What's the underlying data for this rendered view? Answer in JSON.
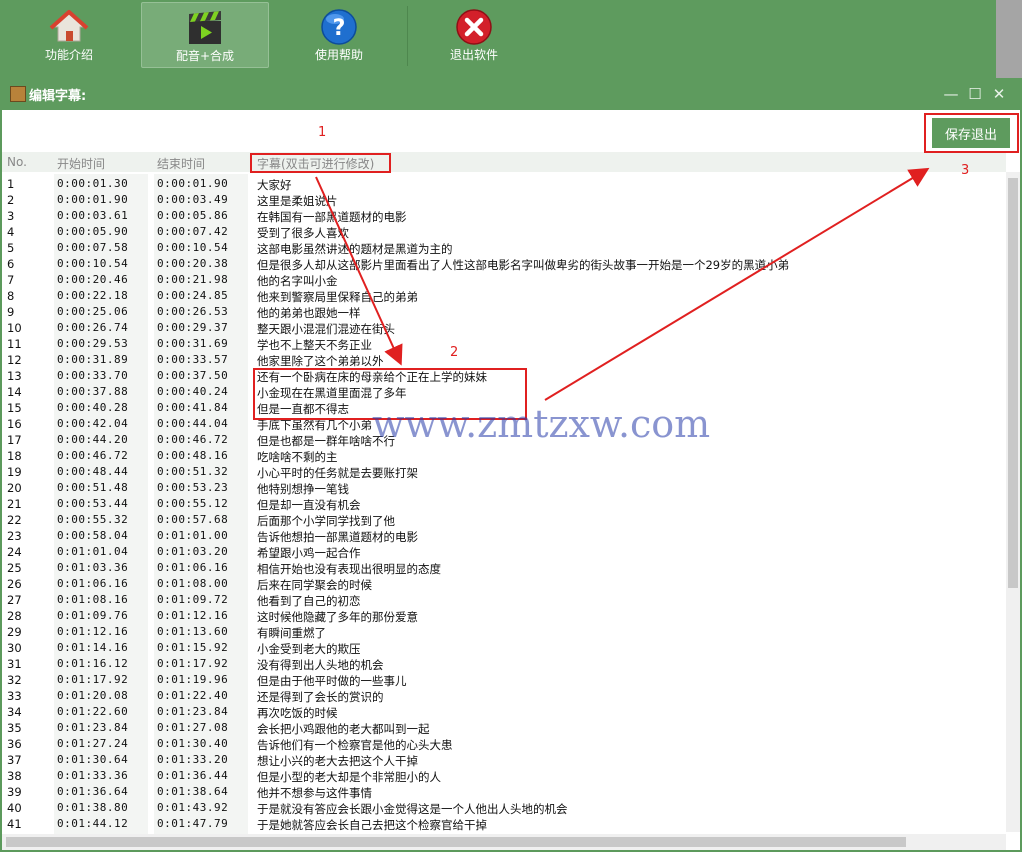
{
  "toolbar": {
    "items": [
      {
        "label": "功能介绍",
        "icon": "home-icon"
      },
      {
        "label": "配音+合成",
        "icon": "video-clapper-icon"
      },
      {
        "label": "使用帮助",
        "icon": "help-icon"
      },
      {
        "label": "退出软件",
        "icon": "exit-icon"
      }
    ]
  },
  "window": {
    "title": "编辑字幕:",
    "minimize_glyph": "—",
    "maximize_glyph": "☐",
    "close_glyph": "✕"
  },
  "save_button_label": "保存退出",
  "table": {
    "headers": [
      "No.",
      "开始时间",
      "结束时间",
      "字幕(双击可进行修改)"
    ],
    "rows": [
      [
        "1",
        "0:00:01.30",
        "0:00:01.90",
        "大家好"
      ],
      [
        "2",
        "0:00:01.90",
        "0:00:03.49",
        "这里是柔姐说片"
      ],
      [
        "3",
        "0:00:03.61",
        "0:00:05.86",
        "在韩国有一部黑道题材的电影"
      ],
      [
        "4",
        "0:00:05.90",
        "0:00:07.42",
        "受到了很多人喜欢"
      ],
      [
        "5",
        "0:00:07.58",
        "0:00:10.54",
        "这部电影虽然讲述的题材是黑道为主的"
      ],
      [
        "6",
        "0:00:10.54",
        "0:00:20.38",
        "但是很多人却从这部影片里面看出了人性这部电影名字叫做卑劣的街头故事一开始是一个29岁的黑道小弟"
      ],
      [
        "7",
        "0:00:20.46",
        "0:00:21.98",
        "他的名字叫小金"
      ],
      [
        "8",
        "0:00:22.18",
        "0:00:24.85",
        "他来到警察局里保释自己的弟弟"
      ],
      [
        "9",
        "0:00:25.06",
        "0:00:26.53",
        "他的弟弟也跟她一样"
      ],
      [
        "10",
        "0:00:26.74",
        "0:00:29.37",
        "整天跟小混混们混迹在街头"
      ],
      [
        "11",
        "0:00:29.53",
        "0:00:31.69",
        "学也不上整天不务正业"
      ],
      [
        "12",
        "0:00:31.89",
        "0:00:33.57",
        "他家里除了这个弟弟以外"
      ],
      [
        "13",
        "0:00:33.70",
        "0:00:37.50",
        "还有一个卧病在床的母亲给个正在上学的妹妹"
      ],
      [
        "14",
        "0:00:37.88",
        "0:00:40.24",
        "小金现在在黑道里面混了多年"
      ],
      [
        "15",
        "0:00:40.28",
        "0:00:41.84",
        "但是一直都不得志"
      ],
      [
        "16",
        "0:00:42.04",
        "0:00:44.04",
        "手底下虽然有几个小弟"
      ],
      [
        "17",
        "0:00:44.20",
        "0:00:46.72",
        "但是也都是一群年啥啥不行"
      ],
      [
        "18",
        "0:00:46.72",
        "0:00:48.16",
        "吃啥啥不剩的主"
      ],
      [
        "19",
        "0:00:48.44",
        "0:00:51.32",
        "小心平时的任务就是去要账打架"
      ],
      [
        "20",
        "0:00:51.48",
        "0:00:53.23",
        "他特别想挣一笔钱"
      ],
      [
        "21",
        "0:00:53.44",
        "0:00:55.12",
        "但是却一直没有机会"
      ],
      [
        "22",
        "0:00:55.32",
        "0:00:57.68",
        "后面那个小学同学找到了他"
      ],
      [
        "23",
        "0:00:58.04",
        "0:01:01.00",
        "告诉他想拍一部黑道题材的电影"
      ],
      [
        "24",
        "0:01:01.04",
        "0:01:03.20",
        "希望跟小鸡一起合作"
      ],
      [
        "25",
        "0:01:03.36",
        "0:01:06.16",
        "相信开始也没有表现出很明显的态度"
      ],
      [
        "26",
        "0:01:06.16",
        "0:01:08.00",
        "后来在同学聚会的时候"
      ],
      [
        "27",
        "0:01:08.16",
        "0:01:09.72",
        "他看到了自己的初恋"
      ],
      [
        "28",
        "0:01:09.76",
        "0:01:12.16",
        "这时候他隐藏了多年的那份爱意"
      ],
      [
        "29",
        "0:01:12.16",
        "0:01:13.60",
        "有瞬间重燃了"
      ],
      [
        "30",
        "0:01:14.16",
        "0:01:15.92",
        "小金受到老大的欺压"
      ],
      [
        "31",
        "0:01:16.12",
        "0:01:17.92",
        "没有得到出人头地的机会"
      ],
      [
        "32",
        "0:01:17.92",
        "0:01:19.96",
        "但是由于他平时做的一些事儿"
      ],
      [
        "33",
        "0:01:20.08",
        "0:01:22.40",
        "还是得到了会长的赏识的"
      ],
      [
        "34",
        "0:01:22.60",
        "0:01:23.84",
        "再次吃饭的时候"
      ],
      [
        "35",
        "0:01:23.84",
        "0:01:27.08",
        "会长把小鸡跟他的老大都叫到一起"
      ],
      [
        "36",
        "0:01:27.24",
        "0:01:30.40",
        "告诉他们有一个检察官是他的心头大患"
      ],
      [
        "37",
        "0:01:30.64",
        "0:01:33.20",
        "想让小兴的老大去把这个人干掉"
      ],
      [
        "38",
        "0:01:33.36",
        "0:01:36.44",
        "但是小型的老大却是个非常胆小的人"
      ],
      [
        "39",
        "0:01:36.64",
        "0:01:38.64",
        "他并不想参与这件事情"
      ],
      [
        "40",
        "0:01:38.80",
        "0:01:43.92",
        "于是就没有答应会长跟小金觉得这是一个人他出人头地的机会"
      ],
      [
        "41",
        "0:01:44.12",
        "0:01:47.79",
        "于是她就答应会长自己去把这个检察官给干掉"
      ]
    ]
  },
  "annotations": {
    "n1": "1",
    "n2": "2",
    "n3": "3"
  },
  "watermark": "www.zmtzxw.com",
  "colors": {
    "theme_green": "#5e9b5e",
    "annotation_red": "#e02020"
  }
}
